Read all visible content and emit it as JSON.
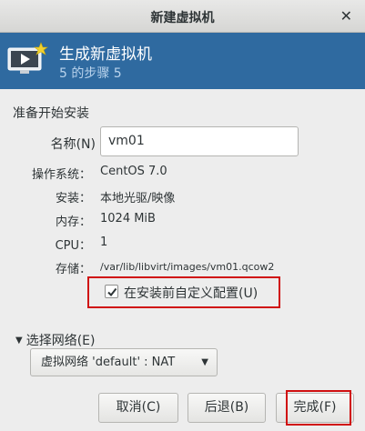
{
  "window": {
    "title": "新建虚拟机",
    "close_glyph": "✕"
  },
  "header": {
    "title": "生成新虚拟机",
    "step": "5 的步骤 5",
    "icon": "vm-monitor-star-icon"
  },
  "section": {
    "title": "准备开始安装"
  },
  "name": {
    "label": "名称(N)",
    "value": "vm01"
  },
  "info": {
    "os_label": "操作系统：",
    "os_value": "CentOS 7.0",
    "install_label": "安装：",
    "install_value": "本地光驱/映像",
    "memory_label": "内存：",
    "memory_value": "1024 MiB",
    "cpu_label": "CPU：",
    "cpu_value": "1",
    "storage_label": "存储：",
    "storage_value": "/var/lib/libvirt/images/vm01.qcow2"
  },
  "customize": {
    "label": "在安装前自定义配置(U)",
    "checked": true
  },
  "network": {
    "expander_label": "选择网络(E)",
    "selected": "虚拟网络 'default' : NAT"
  },
  "buttons": {
    "cancel": "取消(C)",
    "back": "后退(B)",
    "finish": "完成(F)"
  },
  "colors": {
    "header_bg": "#2f6aa0",
    "highlight": "#d01010"
  }
}
